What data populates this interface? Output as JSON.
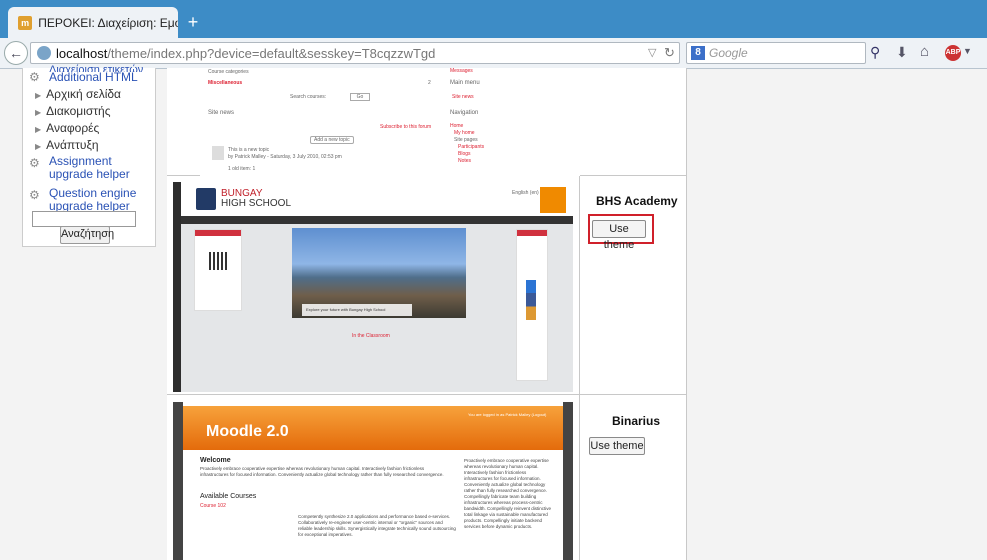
{
  "browser": {
    "tab_title": "ΠΕΡΟΚΕΙ: Διαχείριση: Εμφάνισ...",
    "tab_icon_text": "m",
    "new_tab": "+",
    "url_host": "localhost",
    "url_rest": "/theme/index.php?device=default&sesskey=T8cqzzwTgd",
    "search_engine_icon": "8",
    "search_placeholder": "Google",
    "icons": [
      "back-icon",
      "globe-icon",
      "star-icon",
      "reload-icon",
      "search-icon",
      "download-icon",
      "home-icon",
      "adblock-icon"
    ],
    "abp_text": "ABP"
  },
  "sidebar": {
    "partial_top": "Διαχείριση ετικετών",
    "items": [
      {
        "label": "Additional HTML",
        "type": "gear-link"
      },
      {
        "label": "Αρχική σελίδα",
        "type": "folder"
      },
      {
        "label": "Διακομιστής",
        "type": "folder"
      },
      {
        "label": "Αναφορές",
        "type": "folder"
      },
      {
        "label": "Ανάπτυξη",
        "type": "folder"
      },
      {
        "label": "Assignment upgrade helper",
        "type": "gear-link"
      },
      {
        "label": "Question engine upgrade helper",
        "type": "gear-link"
      }
    ],
    "search_button": "Αναζήτηση"
  },
  "preview_prev": {
    "course_categories": "Course categories",
    "misc": "Miscellaneous",
    "misc_count": "2",
    "search_courses": "Search courses:",
    "go": "Go",
    "site_news": "Site news",
    "subscribe": "Subscribe to this forum",
    "add_topic": "Add a new topic",
    "post_title": "This is a new topic",
    "post_by": "by Patrick Malley - Saturday, 3 July 2010, 02:53 pm",
    "older": "1 old item: 1",
    "main_menu": "Main menu",
    "site_news_link": "Site news",
    "navigation": "Navigation",
    "home": "Home",
    "my_home": "My home",
    "site_pages": "Site pages",
    "participants": "Participants",
    "blogs": "Blogs",
    "notes": "Notes",
    "messages": "Messages"
  },
  "preview_bhs": {
    "logo_line1": "BUNGAY",
    "logo_line2": "HIGH SCHOOL",
    "caption": "Explore your future with Bungay High School",
    "classroom_heading": "In the Classroom",
    "lang": "English (en)"
  },
  "preview_moodle": {
    "title": "Moodle 2.0",
    "top_right": "You are logged in as Patrick Malley (Logout)",
    "welcome": "Welcome",
    "welcome_text": "Proactively embrace cooperative expertise whereas revolutionary human capital. Interactively fashion frictionless infrastructures for focused information. Conveniently actualize global technology rather than fully researched convergence.",
    "available": "Available Courses",
    "course": "Course 102",
    "course_text": "Competently synthesize 2.0 applications and performance based e-services. Collaboratively re-engineer user-centric internal or \"organic\" sources and reliable leadership skills. Synergistically integrate technically sound outsourcing for exceptional imperatives.",
    "side_text": "Proactively embrace cooperative expertise whereas revolutionary human capital. Interactively fashion frictionless infrastructures for focused information. Conveniently actualize global technology rather than fully researched convergence. Compellingly fabricate team building infrastructures whereas process-centric bandwidth. Compellingly reinvent distinctive total linkage via sustainable manufactured products. Compellingly initiate backend services before dynamic products."
  },
  "themes": [
    {
      "name": "BHS Academy",
      "button": "Use theme",
      "highlighted": true
    },
    {
      "name": "Binarius",
      "button": "Use theme",
      "highlighted": false
    }
  ],
  "colors": {
    "chrome_blue": "#3d8cc6",
    "highlight_red": "#d0202a",
    "moodle_orange": "#f08a00",
    "link_blue": "#2a52b5"
  }
}
